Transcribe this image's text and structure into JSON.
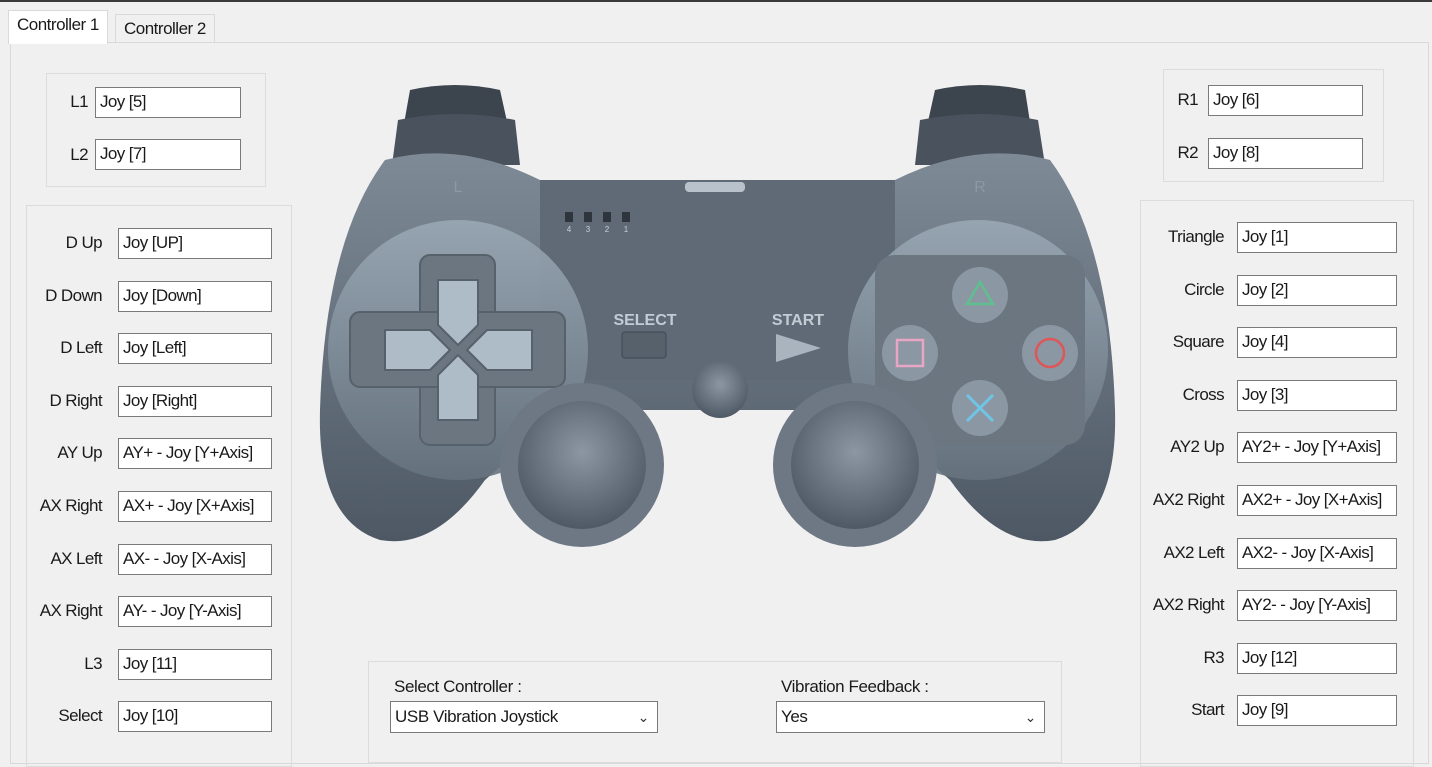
{
  "tabs": [
    {
      "label": "Controller 1",
      "active": true
    },
    {
      "label": "Controller 2",
      "active": false
    }
  ],
  "shoulder_left": [
    {
      "label": "L1",
      "value": "Joy [5]"
    },
    {
      "label": "L2",
      "value": "Joy [7]"
    }
  ],
  "shoulder_right": [
    {
      "label": "R1",
      "value": "Joy [6]"
    },
    {
      "label": "R2",
      "value": "Joy [8]"
    }
  ],
  "left_mappings": [
    {
      "label": "D Up",
      "value": "Joy [UP]"
    },
    {
      "label": "D Down",
      "value": "Joy [Down]"
    },
    {
      "label": "D Left",
      "value": "Joy [Left]"
    },
    {
      "label": "D Right",
      "value": "Joy [Right]"
    },
    {
      "label": "AY Up",
      "value": "AY+ -  Joy [Y+Axis]"
    },
    {
      "label": "AX Right",
      "value": "AX+ -  Joy [X+Axis]"
    },
    {
      "label": "AX Left",
      "value": "AX- -  Joy [X-Axis]"
    },
    {
      "label": "AX Right",
      "value": "AY- -  Joy [Y-Axis]"
    },
    {
      "label": "L3",
      "value": "Joy [11]"
    },
    {
      "label": "Select",
      "value": "Joy [10]"
    }
  ],
  "right_mappings": [
    {
      "label": "Triangle",
      "value": "Joy [1]"
    },
    {
      "label": "Circle",
      "value": "Joy [2]"
    },
    {
      "label": "Square",
      "value": "Joy [4]"
    },
    {
      "label": "Cross",
      "value": "Joy [3]"
    },
    {
      "label": "AY2 Up",
      "value": "AY2+ -  Joy [Y+Axis]"
    },
    {
      "label": "AX2 Right",
      "value": "AX2+ -  Joy [X+Axis]"
    },
    {
      "label": "AX2 Left",
      "value": "AX2- -  Joy [X-Axis]"
    },
    {
      "label": "AX2 Right",
      "value": "AY2- -  Joy [Y-Axis]"
    },
    {
      "label": "R3",
      "value": "Joy [12]"
    },
    {
      "label": "Start",
      "value": " Joy [9]"
    }
  ],
  "bottom": {
    "controller_label": "Select Controller :",
    "controller_value": "USB Vibration Joystick",
    "vibration_label": "Vibration Feedback :",
    "vibration_value": "Yes"
  },
  "gamepad": {
    "left_trigger": "L",
    "right_trigger": "R",
    "select": "SELECT",
    "start": "START",
    "leds": [
      "4",
      "3",
      "2",
      "1"
    ]
  },
  "colors": {
    "triangle": "#5fbf8f",
    "circle": "#e05555",
    "square": "#e8a6c4",
    "cross": "#6fc6e8"
  }
}
